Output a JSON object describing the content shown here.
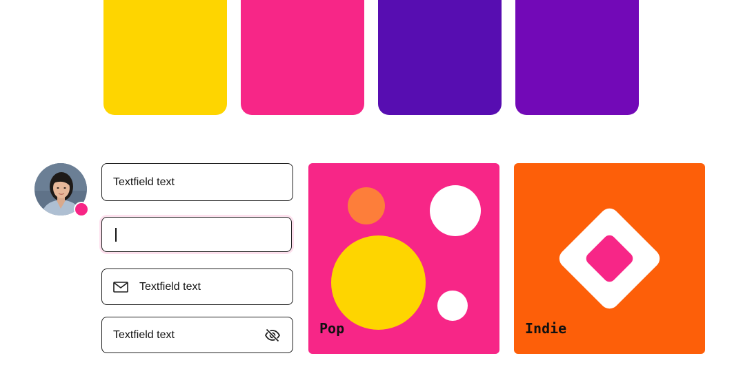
{
  "palette": {
    "swatches": [
      {
        "name": "yellow",
        "color": "#fed500"
      },
      {
        "name": "pink",
        "color": "#f72687"
      },
      {
        "name": "indigo",
        "color": "#570db1"
      },
      {
        "name": "purple",
        "color": "#7209b7"
      }
    ]
  },
  "avatar": {
    "status_color": "#f72585"
  },
  "textfields": [
    {
      "value": "Textfield text",
      "state": "default"
    },
    {
      "value": "",
      "state": "focused"
    },
    {
      "value": "Textfield text",
      "state": "default",
      "leading_icon": "mail-icon"
    },
    {
      "value": "Textfield text",
      "state": "default",
      "trailing_icon": "eye-off-icon"
    }
  ],
  "cards": [
    {
      "label": "Pop",
      "background": "#f72687"
    },
    {
      "label": "Indie",
      "background": "#fd5f09"
    }
  ],
  "colors": {
    "orange_dot": "#fd7e3a",
    "yellow_dot": "#fed500",
    "white": "#ffffff"
  }
}
